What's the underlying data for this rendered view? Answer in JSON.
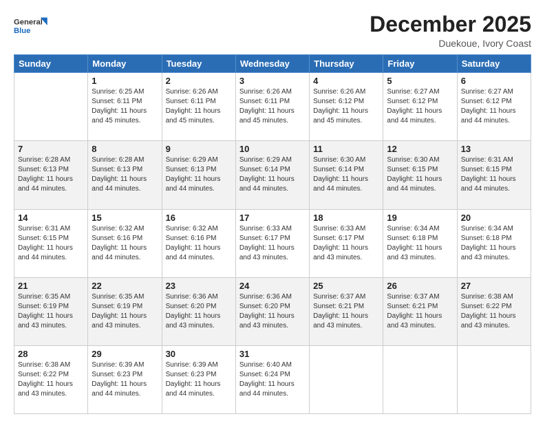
{
  "logo": {
    "line1": "General",
    "line2": "Blue"
  },
  "title": "December 2025",
  "location": "Duekoue, Ivory Coast",
  "days_of_week": [
    "Sunday",
    "Monday",
    "Tuesday",
    "Wednesday",
    "Thursday",
    "Friday",
    "Saturday"
  ],
  "weeks": [
    [
      {
        "day": "",
        "info": ""
      },
      {
        "day": "1",
        "info": "Sunrise: 6:25 AM\nSunset: 6:11 PM\nDaylight: 11 hours\nand 45 minutes."
      },
      {
        "day": "2",
        "info": "Sunrise: 6:26 AM\nSunset: 6:11 PM\nDaylight: 11 hours\nand 45 minutes."
      },
      {
        "day": "3",
        "info": "Sunrise: 6:26 AM\nSunset: 6:11 PM\nDaylight: 11 hours\nand 45 minutes."
      },
      {
        "day": "4",
        "info": "Sunrise: 6:26 AM\nSunset: 6:12 PM\nDaylight: 11 hours\nand 45 minutes."
      },
      {
        "day": "5",
        "info": "Sunrise: 6:27 AM\nSunset: 6:12 PM\nDaylight: 11 hours\nand 44 minutes."
      },
      {
        "day": "6",
        "info": "Sunrise: 6:27 AM\nSunset: 6:12 PM\nDaylight: 11 hours\nand 44 minutes."
      }
    ],
    [
      {
        "day": "7",
        "info": "Sunrise: 6:28 AM\nSunset: 6:13 PM\nDaylight: 11 hours\nand 44 minutes."
      },
      {
        "day": "8",
        "info": "Sunrise: 6:28 AM\nSunset: 6:13 PM\nDaylight: 11 hours\nand 44 minutes."
      },
      {
        "day": "9",
        "info": "Sunrise: 6:29 AM\nSunset: 6:13 PM\nDaylight: 11 hours\nand 44 minutes."
      },
      {
        "day": "10",
        "info": "Sunrise: 6:29 AM\nSunset: 6:14 PM\nDaylight: 11 hours\nand 44 minutes."
      },
      {
        "day": "11",
        "info": "Sunrise: 6:30 AM\nSunset: 6:14 PM\nDaylight: 11 hours\nand 44 minutes."
      },
      {
        "day": "12",
        "info": "Sunrise: 6:30 AM\nSunset: 6:15 PM\nDaylight: 11 hours\nand 44 minutes."
      },
      {
        "day": "13",
        "info": "Sunrise: 6:31 AM\nSunset: 6:15 PM\nDaylight: 11 hours\nand 44 minutes."
      }
    ],
    [
      {
        "day": "14",
        "info": "Sunrise: 6:31 AM\nSunset: 6:15 PM\nDaylight: 11 hours\nand 44 minutes."
      },
      {
        "day": "15",
        "info": "Sunrise: 6:32 AM\nSunset: 6:16 PM\nDaylight: 11 hours\nand 44 minutes."
      },
      {
        "day": "16",
        "info": "Sunrise: 6:32 AM\nSunset: 6:16 PM\nDaylight: 11 hours\nand 44 minutes."
      },
      {
        "day": "17",
        "info": "Sunrise: 6:33 AM\nSunset: 6:17 PM\nDaylight: 11 hours\nand 43 minutes."
      },
      {
        "day": "18",
        "info": "Sunrise: 6:33 AM\nSunset: 6:17 PM\nDaylight: 11 hours\nand 43 minutes."
      },
      {
        "day": "19",
        "info": "Sunrise: 6:34 AM\nSunset: 6:18 PM\nDaylight: 11 hours\nand 43 minutes."
      },
      {
        "day": "20",
        "info": "Sunrise: 6:34 AM\nSunset: 6:18 PM\nDaylight: 11 hours\nand 43 minutes."
      }
    ],
    [
      {
        "day": "21",
        "info": "Sunrise: 6:35 AM\nSunset: 6:19 PM\nDaylight: 11 hours\nand 43 minutes."
      },
      {
        "day": "22",
        "info": "Sunrise: 6:35 AM\nSunset: 6:19 PM\nDaylight: 11 hours\nand 43 minutes."
      },
      {
        "day": "23",
        "info": "Sunrise: 6:36 AM\nSunset: 6:20 PM\nDaylight: 11 hours\nand 43 minutes."
      },
      {
        "day": "24",
        "info": "Sunrise: 6:36 AM\nSunset: 6:20 PM\nDaylight: 11 hours\nand 43 minutes."
      },
      {
        "day": "25",
        "info": "Sunrise: 6:37 AM\nSunset: 6:21 PM\nDaylight: 11 hours\nand 43 minutes."
      },
      {
        "day": "26",
        "info": "Sunrise: 6:37 AM\nSunset: 6:21 PM\nDaylight: 11 hours\nand 43 minutes."
      },
      {
        "day": "27",
        "info": "Sunrise: 6:38 AM\nSunset: 6:22 PM\nDaylight: 11 hours\nand 43 minutes."
      }
    ],
    [
      {
        "day": "28",
        "info": "Sunrise: 6:38 AM\nSunset: 6:22 PM\nDaylight: 11 hours\nand 43 minutes."
      },
      {
        "day": "29",
        "info": "Sunrise: 6:39 AM\nSunset: 6:23 PM\nDaylight: 11 hours\nand 44 minutes."
      },
      {
        "day": "30",
        "info": "Sunrise: 6:39 AM\nSunset: 6:23 PM\nDaylight: 11 hours\nand 44 minutes."
      },
      {
        "day": "31",
        "info": "Sunrise: 6:40 AM\nSunset: 6:24 PM\nDaylight: 11 hours\nand 44 minutes."
      },
      {
        "day": "",
        "info": ""
      },
      {
        "day": "",
        "info": ""
      },
      {
        "day": "",
        "info": ""
      }
    ]
  ]
}
